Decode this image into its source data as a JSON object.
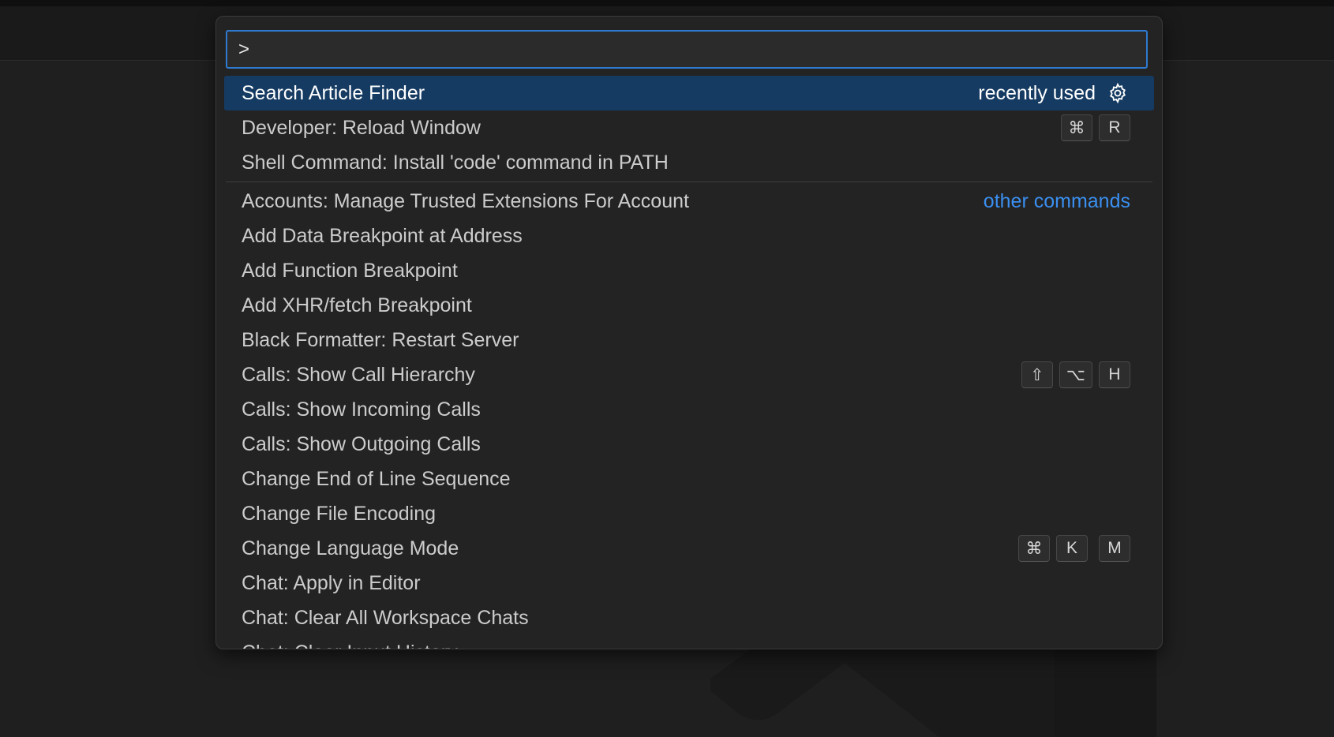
{
  "search": {
    "value": ">",
    "placeholder": ""
  },
  "items": [
    {
      "label": "Search Article Finder",
      "tag": "recently used",
      "gear": "gear-icon",
      "selected": true
    },
    {
      "label": "Developer: Reload Window",
      "keys": [
        "⌘",
        "R"
      ]
    },
    {
      "label": "Shell Command: Install 'code' command in PATH"
    },
    {
      "label": "Accounts: Manage Trusted Extensions For Account",
      "tag": "other commands"
    },
    {
      "label": "Add Data Breakpoint at Address"
    },
    {
      "label": "Add Function Breakpoint"
    },
    {
      "label": "Add XHR/fetch Breakpoint"
    },
    {
      "label": "Black Formatter: Restart Server"
    },
    {
      "label": "Calls: Show Call Hierarchy",
      "keys": [
        "⇧",
        "⌥",
        "H"
      ]
    },
    {
      "label": "Calls: Show Incoming Calls"
    },
    {
      "label": "Calls: Show Outgoing Calls"
    },
    {
      "label": "Change End of Line Sequence"
    },
    {
      "label": "Change File Encoding"
    },
    {
      "label": "Change Language Mode",
      "keys": [
        "⌘",
        "K",
        "M"
      ]
    },
    {
      "label": "Chat: Apply in Editor"
    },
    {
      "label": "Chat: Clear All Workspace Chats"
    },
    {
      "label": "Chat: Clear Input History"
    }
  ],
  "colors": {
    "accent": "#2f7ad1",
    "selected_bg": "#153b62",
    "link": "#3a8ff0"
  }
}
